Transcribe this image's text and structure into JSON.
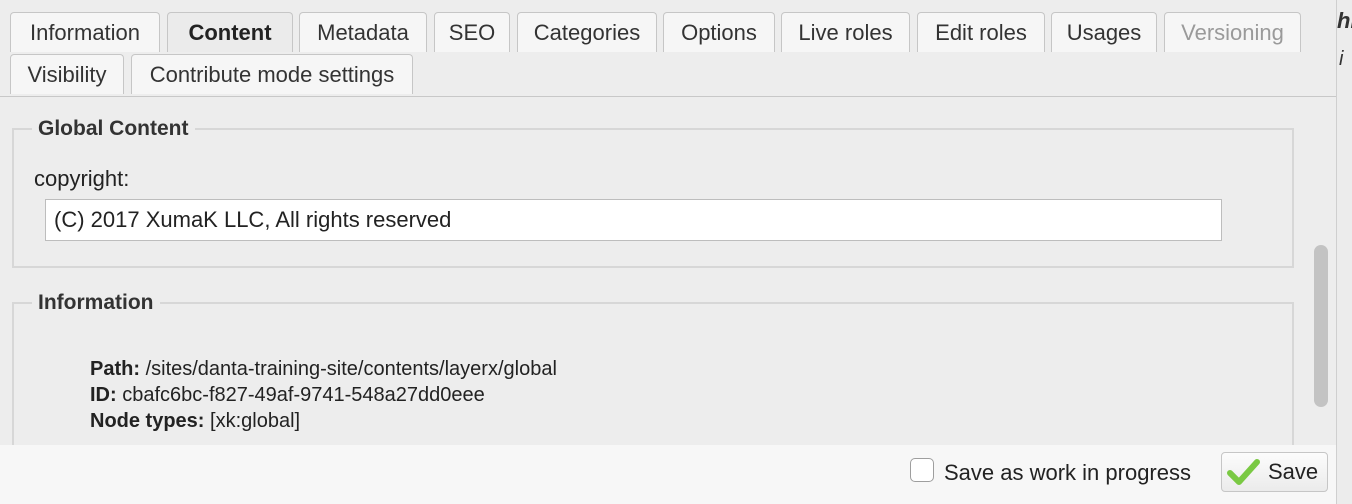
{
  "tabs": [
    {
      "label": "Information",
      "state": "normal"
    },
    {
      "label": "Content",
      "state": "active"
    },
    {
      "label": "Metadata",
      "state": "normal"
    },
    {
      "label": "SEO",
      "state": "normal"
    },
    {
      "label": "Categories",
      "state": "normal"
    },
    {
      "label": "Options",
      "state": "normal"
    },
    {
      "label": "Live roles",
      "state": "normal"
    },
    {
      "label": "Edit roles",
      "state": "normal"
    },
    {
      "label": "Usages",
      "state": "normal"
    },
    {
      "label": "Versioning",
      "state": "disabled"
    },
    {
      "label": "Visibility",
      "state": "normal"
    },
    {
      "label": "Contribute mode settings",
      "state": "normal"
    }
  ],
  "global_content": {
    "legend": "Global Content",
    "copyright_label": "copyright:",
    "copyright_value": "(C) 2017 XumaK LLC, All rights reserved"
  },
  "information": {
    "legend": "Information",
    "path_label": "Path:",
    "path_value": "/sites/danta-training-site/contents/layerx/global",
    "id_label": "ID:",
    "id_value": "cbafc6bc-f827-49af-9741-548a27dd0eee",
    "node_types_label": "Node types:",
    "node_types_value": "[xk:global]"
  },
  "footer": {
    "wip_label": "Save as work in progress",
    "wip_checked": false,
    "save_label": "Save"
  },
  "right_peek": {
    "line1": "hi",
    "line2": "i"
  },
  "colors": {
    "panel_bg": "#ededed",
    "check_green": "#7ac943",
    "disabled_text": "#9a9a9a"
  },
  "icons": {
    "save": "checkmark-icon"
  }
}
